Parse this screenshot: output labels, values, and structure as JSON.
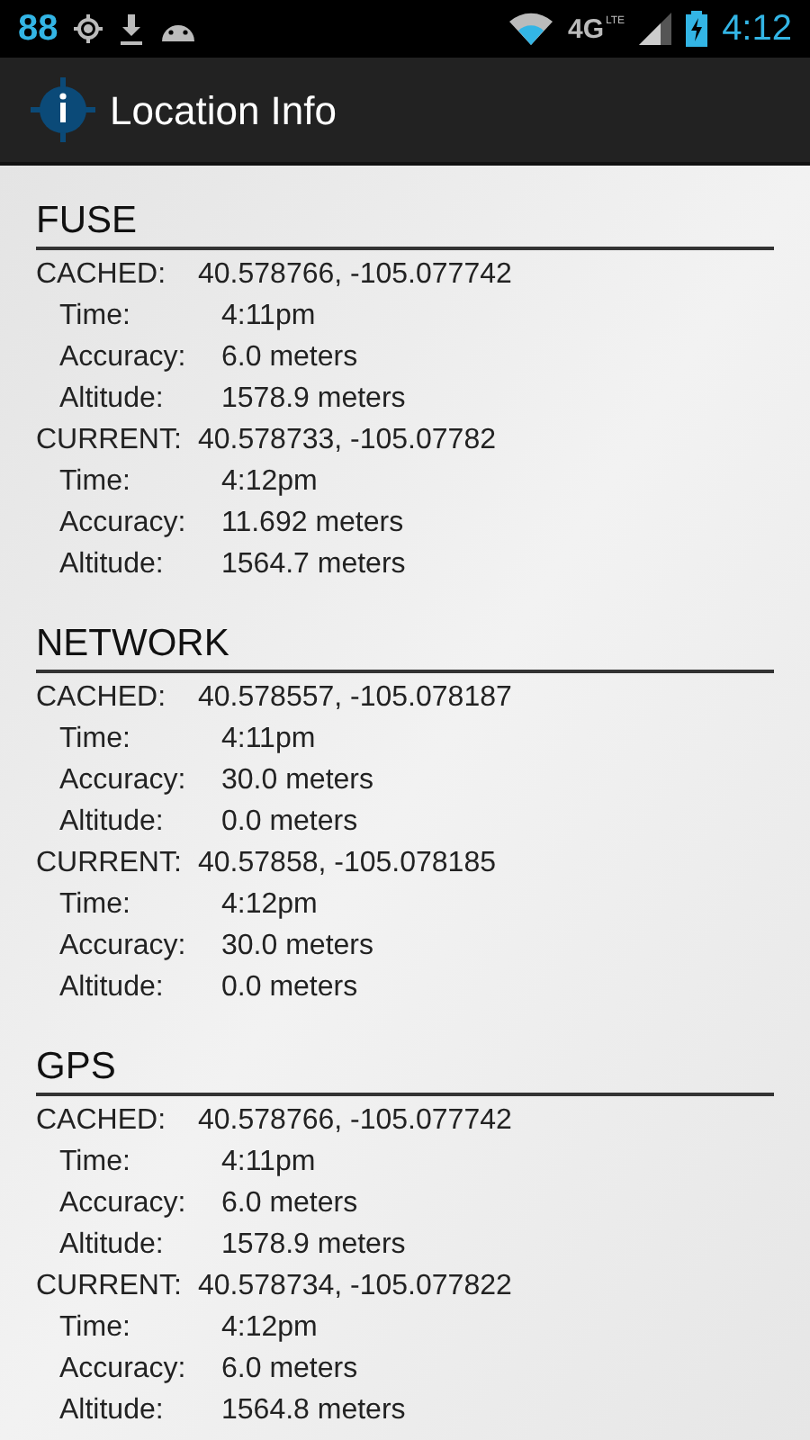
{
  "status_bar": {
    "notification_count": "88",
    "network_type": "4G",
    "network_subtype": "LTE",
    "time": "4:12"
  },
  "app_bar": {
    "title": "Location Info"
  },
  "sections": [
    {
      "title": "FUSE",
      "fixes": [
        {
          "label": "CACHED:",
          "coords": "40.578766, -105.077742",
          "details": [
            {
              "label": "Time:",
              "value": "4:11pm"
            },
            {
              "label": "Accuracy:",
              "value": "6.0 meters"
            },
            {
              "label": "Altitude:",
              "value": "1578.9 meters"
            }
          ]
        },
        {
          "label": "CURRENT:",
          "coords": "40.578733, -105.07782",
          "details": [
            {
              "label": "Time:",
              "value": "4:12pm"
            },
            {
              "label": "Accuracy:",
              "value": "11.692 meters"
            },
            {
              "label": "Altitude:",
              "value": "1564.7 meters"
            }
          ]
        }
      ]
    },
    {
      "title": "NETWORK",
      "fixes": [
        {
          "label": "CACHED:",
          "coords": "40.578557, -105.078187",
          "details": [
            {
              "label": "Time:",
              "value": "4:11pm"
            },
            {
              "label": "Accuracy:",
              "value": "30.0 meters"
            },
            {
              "label": "Altitude:",
              "value": "0.0 meters"
            }
          ]
        },
        {
          "label": "CURRENT:",
          "coords": "40.57858, -105.078185",
          "details": [
            {
              "label": "Time:",
              "value": "4:12pm"
            },
            {
              "label": "Accuracy:",
              "value": "30.0 meters"
            },
            {
              "label": "Altitude:",
              "value": "0.0 meters"
            }
          ]
        }
      ]
    },
    {
      "title": "GPS",
      "fixes": [
        {
          "label": "CACHED:",
          "coords": "40.578766, -105.077742",
          "details": [
            {
              "label": "Time:",
              "value": "4:11pm"
            },
            {
              "label": "Accuracy:",
              "value": "6.0 meters"
            },
            {
              "label": "Altitude:",
              "value": "1578.9 meters"
            }
          ]
        },
        {
          "label": "CURRENT:",
          "coords": "40.578734, -105.077822",
          "details": [
            {
              "label": "Time:",
              "value": "4:12pm"
            },
            {
              "label": "Accuracy:",
              "value": "6.0 meters"
            },
            {
              "label": "Altitude:",
              "value": "1564.8 meters"
            }
          ]
        }
      ]
    }
  ]
}
